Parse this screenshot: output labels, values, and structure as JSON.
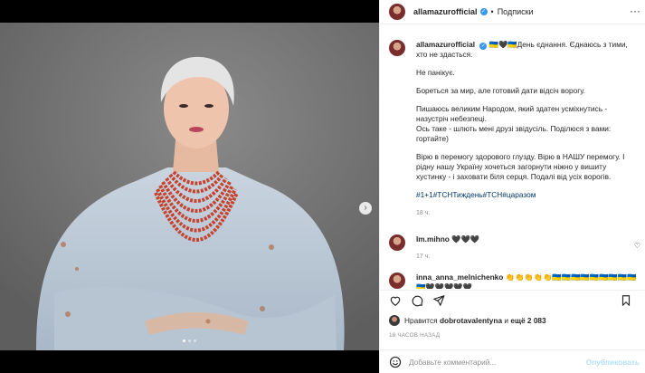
{
  "post": {
    "username": "allamazurofficial",
    "follow_label": "Подписки",
    "more_icon": "more-dots-icon"
  },
  "caption": {
    "username": "allamazurofficial",
    "first_line": "🇺🇦🖤🇺🇦День єднання. Єднаюсь з тими, хто не здасться.",
    "paragraphs": [
      "Не панікує.",
      "Бореться за мир, але готовий дати відсіч ворогу.",
      "Пишаюсь великим Народом, який здатен усміхнутись - назустріч небезпеці.\nОсь таке - шлють мені друзі звідусіль. Поділюся з вами: гортайте)",
      "Вірю в перемогу здорового глузду. Вірю в НАШУ перемогу. І рідну нашу Україну хочеться загорнути ніжно у вишиту хустинку - і заховати біля серця. Подалі від усіх ворогів."
    ],
    "hashtags": "#1+1#ТСНТиждень#ТСН#царазом",
    "time": "18 ч."
  },
  "comments": [
    {
      "username": "lm.mihno",
      "text": "🖤🖤🖤",
      "time": "17 ч."
    },
    {
      "username": "inna_anna_melnichenko",
      "text": "👏👏👏👏👏🇺🇦🇺🇦🇺🇦🇺🇦🇺🇦🇺🇦🇺🇦🇺🇦🇺🇦🇺🇦🖤🖤🖤🖤🖤",
      "time": ""
    }
  ],
  "likes": {
    "prefix": "Нравится",
    "user": "dobrotavalentyna",
    "middle": "и",
    "others": "ещё 2 083"
  },
  "post_time": "18 ЧАСОВ НАЗАД",
  "comment_box": {
    "placeholder": "Добавьте комментарий...",
    "publish_label": "Опубликовать"
  },
  "carousel": {
    "slides": 3,
    "active": 1
  },
  "colors": {
    "verified": "#3897f0",
    "link": "#00376b",
    "publish": "#b2dffc",
    "background_photo": "#7b7b7b"
  }
}
